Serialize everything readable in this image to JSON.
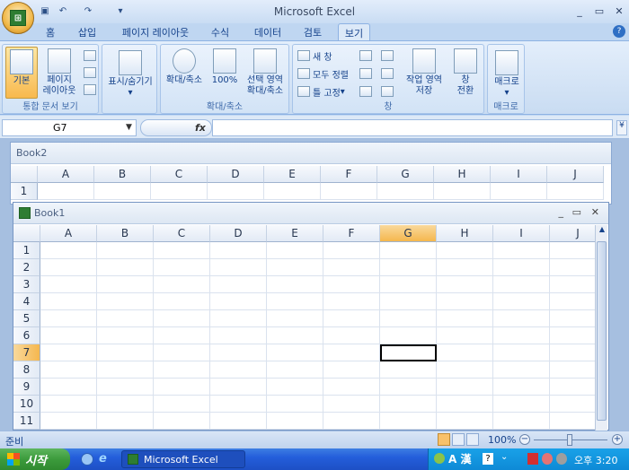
{
  "app": {
    "title": "Microsoft Excel"
  },
  "quick_access": [
    "save-icon",
    "undo-icon",
    "redo-icon",
    "customize-icon"
  ],
  "tabs": [
    "홈",
    "삽입",
    "페이지 레이아웃",
    "수식",
    "데이터",
    "검토",
    "보기"
  ],
  "active_tab": "보기",
  "ribbon": {
    "group_views": {
      "label": "통합 문서 보기",
      "normal": "기본",
      "page_layout": "페이지\n레이아웃"
    },
    "group_show": {
      "label": "표시/숨기기"
    },
    "group_zoom": {
      "label": "확대/축소",
      "zoom": "확대/축소",
      "pct": "100%",
      "sel_zoom": "선택 영역\n확대/축소"
    },
    "group_window": {
      "label": "창",
      "new_window": "새 창",
      "arrange_all": "모두 정렬",
      "freeze": "틀 고정",
      "save_ws": "작업 영역\n저장",
      "switch": "창\n전환"
    },
    "group_macro": {
      "label": "매크로",
      "macro": "매크로"
    }
  },
  "formula_bar": {
    "name_box": "G7",
    "fx": "fx",
    "formula": ""
  },
  "workbooks": [
    {
      "title": "Book2",
      "rows": [
        "1"
      ]
    },
    {
      "title": "Book1",
      "rows": [
        "1",
        "2",
        "3",
        "4",
        "5",
        "6",
        "7",
        "8",
        "9",
        "10",
        "11"
      ]
    }
  ],
  "columns": [
    "A",
    "B",
    "C",
    "D",
    "E",
    "F",
    "G",
    "H",
    "I",
    "J"
  ],
  "active_cell": {
    "col": "G",
    "row": "7"
  },
  "status": {
    "text": "준비",
    "zoom": "100%"
  },
  "taskbar": {
    "start": "시작",
    "task": "Microsoft Excel",
    "ime": "A 漢",
    "clock": "오후 3:20"
  },
  "colors": {
    "highlight": "#f5b74e",
    "ribbon": "#dce9f8"
  }
}
